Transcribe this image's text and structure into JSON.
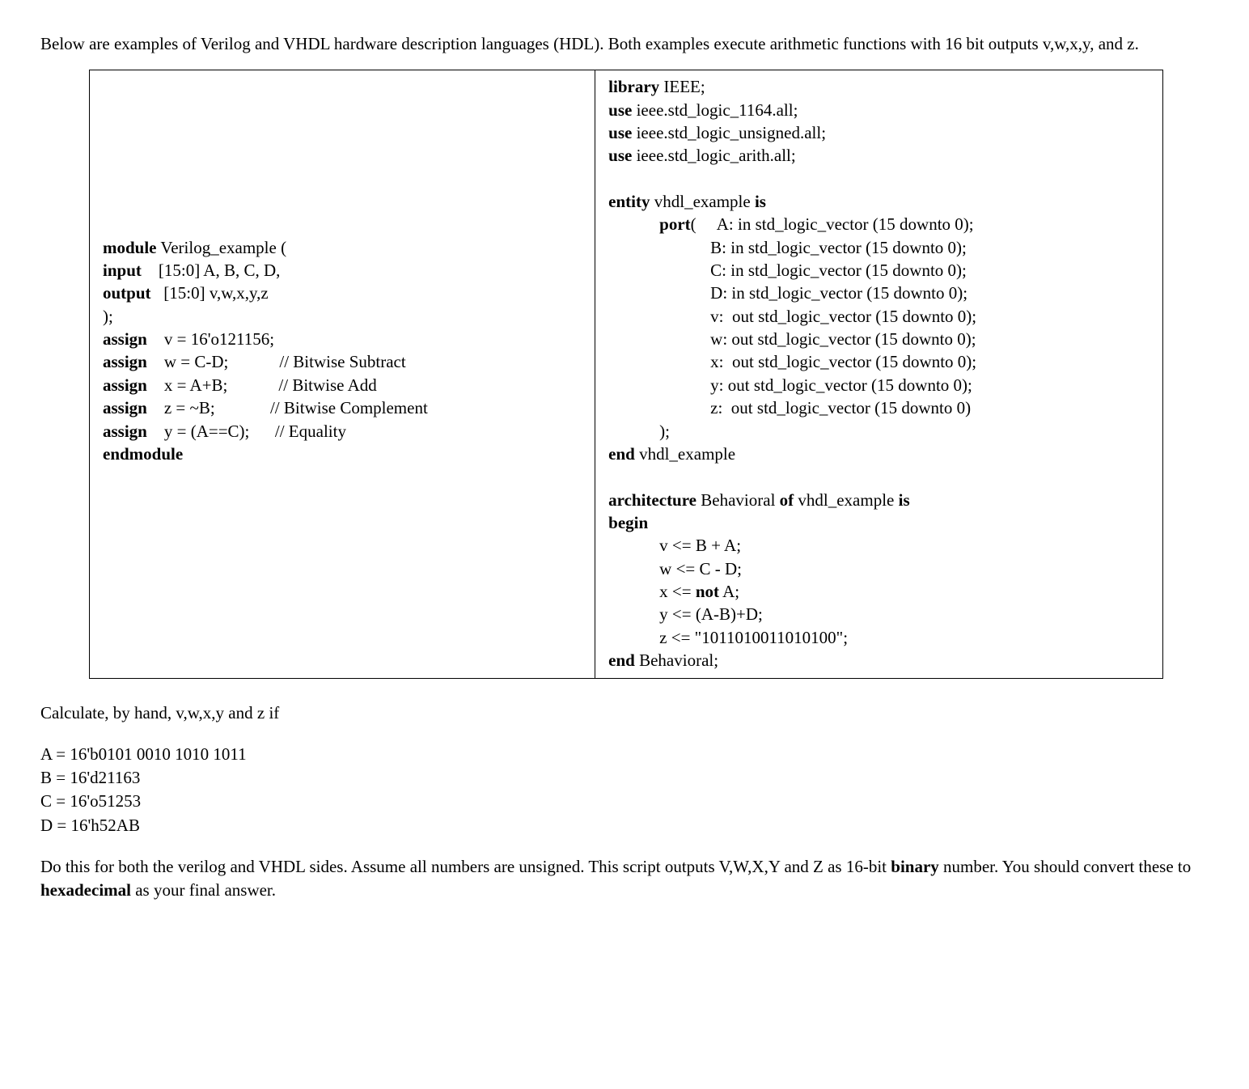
{
  "intro": "Below are examples of Verilog and VHDL hardware description languages (HDL).  Both examples execute arithmetic functions with 16 bit outputs v,w,x,y, and z.",
  "verilog": {
    "l1_kw": "module",
    "l1_rest": " Verilog_example (",
    "l2_kw": "input",
    "l2_rest": "    [15:0] A, B, C, D,",
    "l3_kw": "output",
    "l3_rest": "   [15:0] v,w,x,y,z",
    "l4": ");",
    "l5_kw": "assign",
    "l5_rest": "    v = 16'o121156;",
    "l6_kw": "assign",
    "l6_rest": "    w = C-D;            // Bitwise Subtract",
    "l7_kw": "assign",
    "l7_rest": "    x = A+B;            // Bitwise Add",
    "l8_kw": "assign",
    "l8_rest": "    z = ~B;             // Bitwise Complement",
    "l9_kw": "assign",
    "l9_rest": "    y = (A==C);      // Equality",
    "l10_kw": "endmodule"
  },
  "vhdl": {
    "l1_kw": "library",
    "l1_rest": " IEEE;",
    "l2_kw": "use",
    "l2_rest": " ieee.std_logic_1164.all;",
    "l3_kw": "use",
    "l3_rest": " ieee.std_logic_unsigned.all;",
    "l4_kw": "use",
    "l4_rest": " ieee.std_logic_arith.all;",
    "blank1": "",
    "l5_kw": "entity",
    "l5_mid": " vhdl_example ",
    "l5_kw2": "is",
    "l6_pre": "            ",
    "l6_kw": "port",
    "l6_rest": "(     A: in std_logic_vector (15 downto 0);",
    "l7": "                        B: in std_logic_vector (15 downto 0);",
    "l8": "                        C: in std_logic_vector (15 downto 0);",
    "l9": "                        D: in std_logic_vector (15 downto 0);",
    "l10": "                        v:  out std_logic_vector (15 downto 0);",
    "l11": "                        w: out std_logic_vector (15 downto 0);",
    "l12": "                        x:  out std_logic_vector (15 downto 0);",
    "l13": "                        y: out std_logic_vector (15 downto 0);",
    "l14": "                        z:  out std_logic_vector (15 downto 0)",
    "l15": "            );",
    "l16_kw": "end",
    "l16_rest": " vhdl_example",
    "blank2": "",
    "l17_kw": "architecture",
    "l17_mid": " Behavioral ",
    "l17_kw2": "of",
    "l17_mid2": " vhdl_example ",
    "l17_kw3": "is",
    "l18_kw": "begin",
    "l19": "            v <= B + A;",
    "l20": "            w <= C - D;",
    "l21_pre": "            x <= ",
    "l21_kw": "not",
    "l21_rest": " A;",
    "l22": "            y <= (A-B)+D;",
    "l23": "            z <= \"1011010011010100\";",
    "l24_kw": "end",
    "l24_rest": " Behavioral;"
  },
  "question_line": "Calculate, by hand, v,w,x,y and z if",
  "vals": {
    "a": "A = 16'b0101 0010 1010 1011",
    "b": "B = 16'd21163",
    "c": "C = 16'o51253",
    "d": "D = 16'h52AB"
  },
  "final": {
    "t1": "Do this for both the verilog and VHDL sides.  Assume all numbers are unsigned.  This script outputs V,W,X,Y and Z as 16-bit ",
    "b1": "binary",
    "t2": " number.  You should convert these to ",
    "b2": "hexadecimal",
    "t3": " as your final answer."
  }
}
